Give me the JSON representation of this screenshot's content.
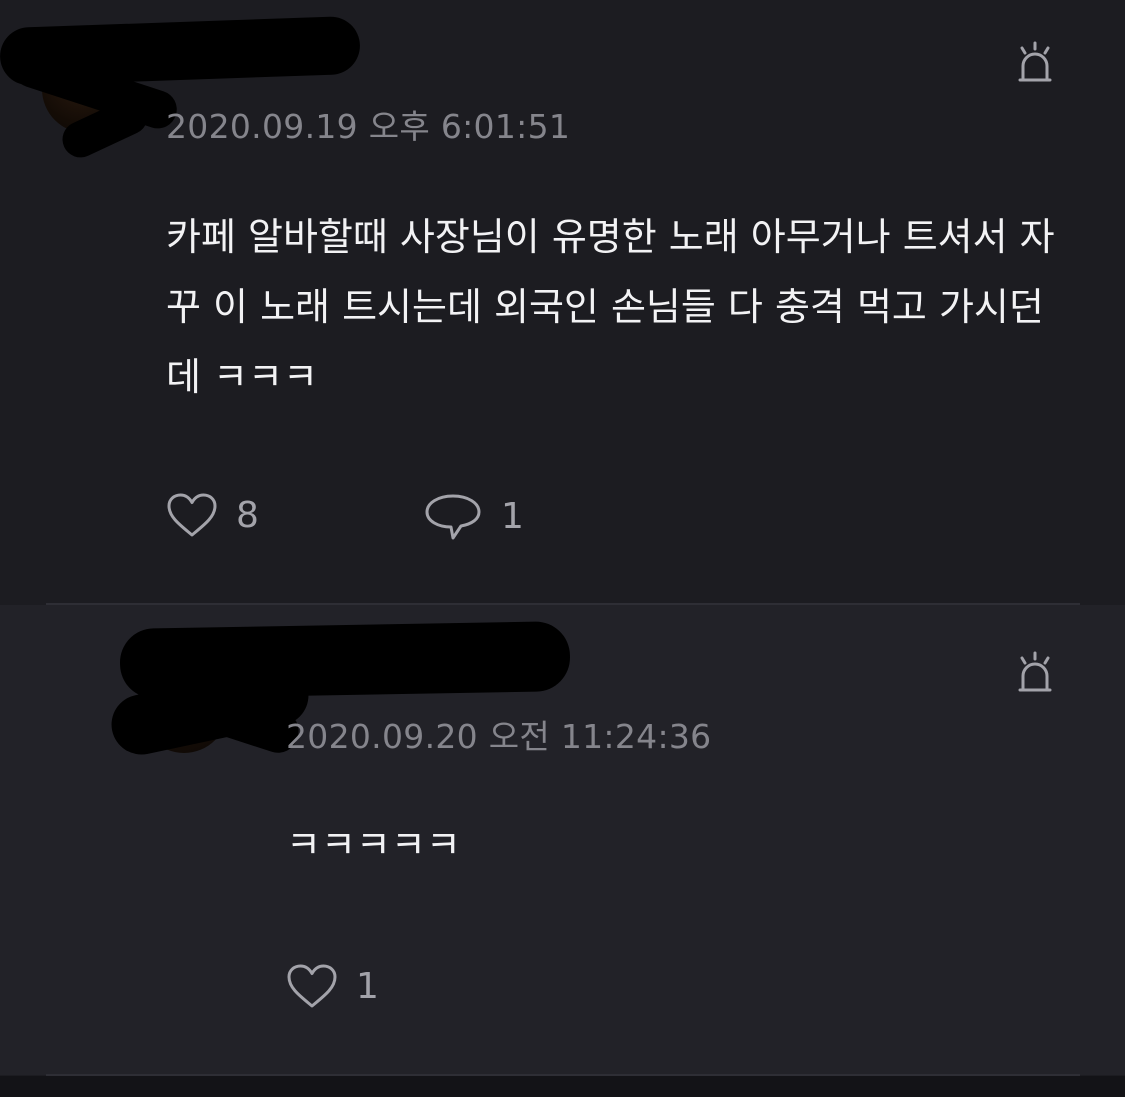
{
  "comments": [
    {
      "timestamp": "2020.09.19 오후 6:01:51",
      "text": "카페 알바할때 사장님이 유명한 노래 아무거나 트셔서 자꾸 이 노래 트시는데 외국인 손님들 다 충격 먹고 가시던데 ㅋㅋㅋ",
      "like_count": "8",
      "reply_count": "1"
    },
    {
      "timestamp": "2020.09.20 오전 11:24:36",
      "text": "ㅋㅋㅋㅋㅋ",
      "like_count": "1"
    }
  ],
  "colors": {
    "background": "#1c1c21",
    "reply_background": "#222228",
    "text": "#f2f2f4",
    "muted": "#85858c",
    "icon": "#a3a3aa"
  },
  "icons": {
    "like": "heart-icon",
    "reply": "speech-bubble-icon",
    "report": "siren-icon"
  }
}
